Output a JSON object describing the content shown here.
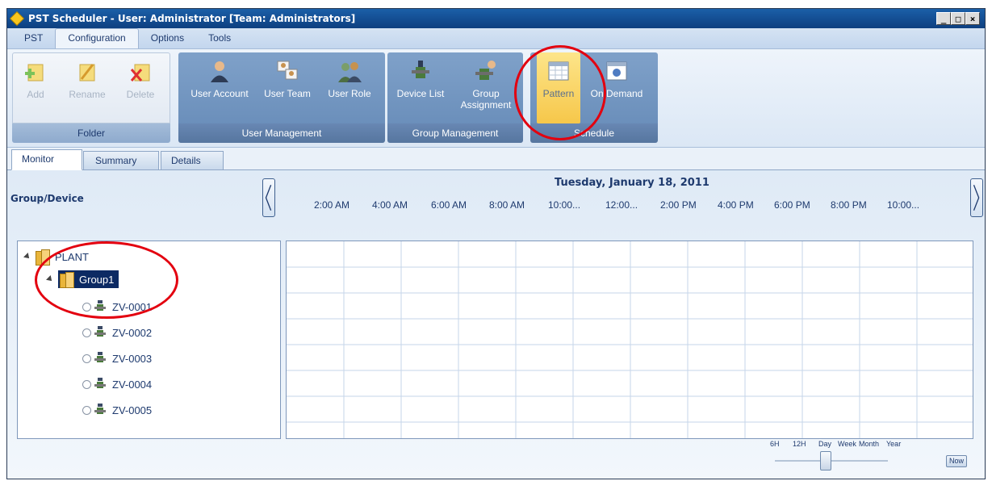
{
  "window": {
    "title": "PST Scheduler - User: Administrator [Team: Administrators]",
    "controls": [
      "minimize-icon",
      "maximize-icon",
      "close-icon"
    ]
  },
  "menu": {
    "tabs": [
      {
        "label": "PST",
        "active": false
      },
      {
        "label": "Configuration",
        "active": true
      },
      {
        "label": "Options",
        "active": false
      },
      {
        "label": "Tools",
        "active": false
      }
    ]
  },
  "ribbon": {
    "groups": [
      {
        "label": "Folder",
        "buttons": [
          {
            "label": "Add",
            "icon": "folder-add-icon",
            "enabled": false
          },
          {
            "label": "Rename",
            "icon": "folder-rename-icon",
            "enabled": false
          },
          {
            "label": "Delete",
            "icon": "folder-delete-icon",
            "enabled": false
          }
        ]
      },
      {
        "label": "User Management",
        "buttons": [
          {
            "label": "User Account",
            "icon": "user-account-icon"
          },
          {
            "label": "User Team",
            "icon": "user-team-icon"
          },
          {
            "label": "User Role",
            "icon": "user-role-icon"
          }
        ]
      },
      {
        "label": "Group Management",
        "buttons": [
          {
            "label": "Device List",
            "icon": "device-list-icon"
          },
          {
            "label": "Group Assignment",
            "icon": "group-assignment-icon"
          }
        ]
      },
      {
        "label": "Schedule",
        "buttons": [
          {
            "label": "Pattern",
            "icon": "calendar-pattern-icon",
            "pressed": true
          },
          {
            "label": "On Demand",
            "icon": "calendar-on-demand-icon"
          }
        ]
      }
    ]
  },
  "view_tabs": [
    {
      "label": "Monitor",
      "active": true
    },
    {
      "label": "Summary",
      "active": false
    },
    {
      "label": "Details",
      "active": false
    }
  ],
  "monitor": {
    "tree_header": "Group/Device",
    "tree": {
      "root": "PLANT",
      "group": "Group1",
      "devices": [
        "ZV-0001",
        "ZV-0002",
        "ZV-0003",
        "ZV-0004",
        "ZV-0005"
      ]
    },
    "date": "Tuesday, January 18, 2011",
    "time_labels": [
      "2:00 AM",
      "4:00 AM",
      "6:00 AM",
      "8:00 AM",
      "10:00...",
      "12:00...",
      "2:00 PM",
      "4:00 PM",
      "6:00 PM",
      "8:00 PM",
      "10:00..."
    ],
    "zoom": {
      "levels": [
        "6H",
        "12H",
        "Day",
        "Week",
        "Month",
        "Year"
      ],
      "selected": "Day",
      "now_label": "Now"
    }
  },
  "colors": {
    "title_bar": "#0d3f80",
    "ribbon_group": "#6b8fbb",
    "selection": "#0c2a63",
    "highlight_circle": "#e3000f",
    "pressed_button": "#f6c74a"
  }
}
